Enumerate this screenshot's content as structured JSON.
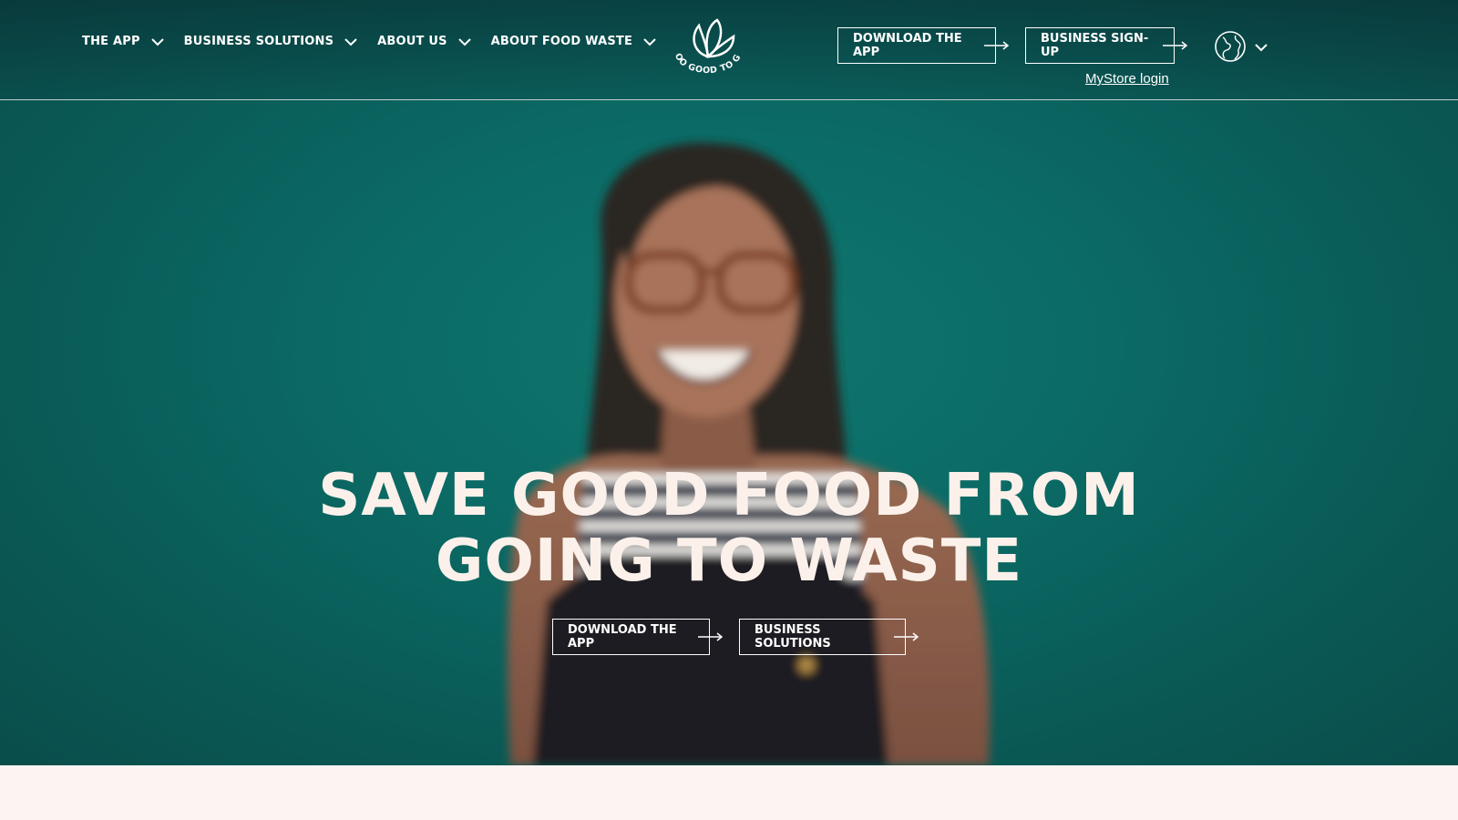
{
  "header": {
    "nav": [
      {
        "label": "THE APP"
      },
      {
        "label": "BUSINESS SOLUTIONS"
      },
      {
        "label": "ABOUT US"
      },
      {
        "label": "ABOUT FOOD WASTE"
      }
    ],
    "logo_text": "TOO GOOD TO GO",
    "download_label": "DOWNLOAD THE APP",
    "business_signup_label": "BUSINESS SIGN-UP",
    "mystore_label": "MyStore login",
    "language_icon": "globe-icon"
  },
  "hero": {
    "headline_line1": "SAVE GOOD FOOD FROM",
    "headline_line2": "GOING TO WASTE",
    "cta_download_label": "DOWNLOAD THE APP",
    "cta_business_label": "BUSINESS SOLUTIONS"
  },
  "colors": {
    "hero_teal": "#0b6b66",
    "headline": "#fbf1ea",
    "page_bg": "#fcf4f2"
  }
}
